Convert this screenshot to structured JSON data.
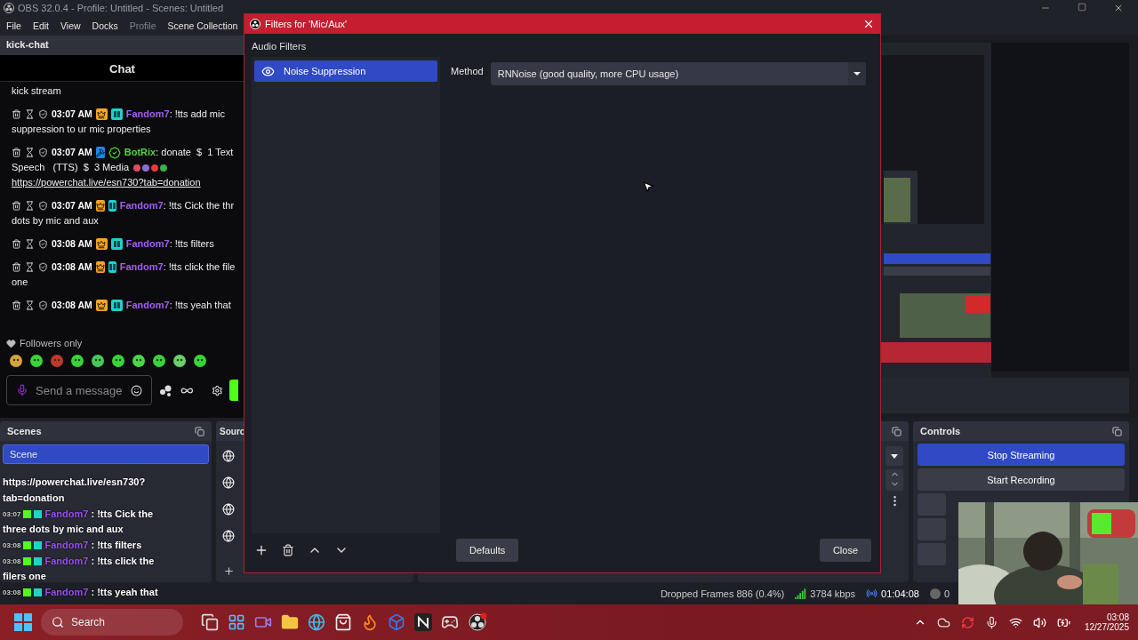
{
  "window": {
    "title": "OBS 32.0.4 - Profile: Untitled - Scenes: Untitled"
  },
  "menu": [
    {
      "label": "File",
      "disabled": false
    },
    {
      "label": "Edit",
      "disabled": false
    },
    {
      "label": "View",
      "disabled": false
    },
    {
      "label": "Docks",
      "disabled": false
    },
    {
      "label": "Profile",
      "disabled": true
    },
    {
      "label": "Scene Collection",
      "disabled": false
    }
  ],
  "chat_dock": {
    "title": "kick-chat",
    "header": "Chat",
    "messages": [
      {
        "kind": "continuation",
        "text": "kick stream"
      },
      {
        "kind": "sub_message",
        "time": "03:07 AM",
        "user": "Fandom7",
        "color": "#a45cf5",
        "text": ": !tts add mic",
        "continuation": "suppression to ur mic properties"
      },
      {
        "kind": "bot_message",
        "time": "03:07 AM",
        "user": "BotRix",
        "color": "#53d63f",
        "text": ": donate  $  1 Text",
        "continuation": "Speech   (TTS)  $  3 Media",
        "link": "https://powerchat.live/esn730?tab=donation"
      },
      {
        "kind": "sub_message",
        "time": "03:07 AM",
        "user": "Fandom7",
        "color": "#a45cf5",
        "text": ": !tts Cick the thr",
        "continuation": "dots by mic and aux"
      },
      {
        "kind": "sub_message",
        "time": "03:08 AM",
        "user": "Fandom7",
        "color": "#a45cf5",
        "text": ": !tts filters"
      },
      {
        "kind": "sub_message",
        "time": "03:08 AM",
        "user": "Fandom7",
        "color": "#a45cf5",
        "text": ": !tts click the file",
        "continuation": "one"
      },
      {
        "kind": "sub_message",
        "time": "03:08 AM",
        "user": "Fandom7",
        "color": "#a45cf5",
        "text": ": !tts yeah that"
      }
    ],
    "mode": "Followers only",
    "input": {
      "placeholder": "Send a message"
    }
  },
  "scenes_dock": {
    "title": "Scenes",
    "items": [
      {
        "label": "Scene",
        "selected": true
      }
    ]
  },
  "sources_dock": {
    "title": "Sourc"
  },
  "chat_overlay": [
    {
      "kind": "text",
      "text": "https://powerchat.live/esn730?"
    },
    {
      "kind": "text",
      "text": "tab=donation"
    },
    {
      "kind": "message",
      "time": "03:07",
      "user": "Fandom7",
      "text": " : !tts Cick the",
      "continuation": "three dots by mic and aux"
    },
    {
      "kind": "message",
      "time": "03:08",
      "user": "Fandom7",
      "text": " : !tts filters"
    },
    {
      "kind": "message",
      "time": "03:08",
      "user": "Fandom7",
      "text": " : !tts click the",
      "continuation": "filers one"
    },
    {
      "kind": "message",
      "time": "03:08",
      "user": "Fandom7",
      "text": " : !tts yeah that"
    }
  ],
  "controls_dock": {
    "title": "Controls",
    "buttons": [
      {
        "label": "Stop Streaming",
        "active": true
      },
      {
        "label": "Start Recording",
        "active": false
      }
    ]
  },
  "status_bar": {
    "dropped": "Dropped Frames 886 (0.4%)",
    "bitrate": "3784 kbps",
    "time": "01:04:08",
    "recording": "0"
  },
  "dialog": {
    "title": "Filters for 'Mic/Aux'",
    "section": "Audio Filters",
    "filters": [
      {
        "label": "Noise Suppression",
        "visible": true,
        "selected": true
      }
    ],
    "method_label": "Method",
    "method_value": "RNNoise (good quality, more CPU usage)",
    "defaults": "Defaults",
    "close": "Close"
  },
  "taskbar": {
    "search": {
      "placeholder": "Search"
    },
    "time": "03:08",
    "date": "12/27/2025"
  }
}
